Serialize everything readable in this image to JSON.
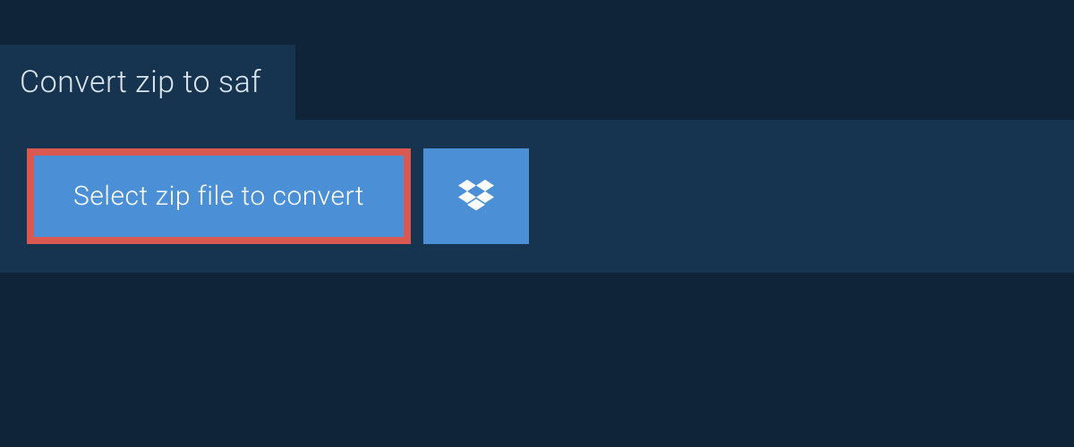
{
  "header": {
    "title": "Convert zip to saf"
  },
  "actions": {
    "select_file_label": "Select zip file to convert",
    "dropbox_icon_name": "dropbox-icon"
  },
  "colors": {
    "background_dark": "#0f2438",
    "panel": "#163450",
    "button_primary": "#4b90d6",
    "highlight_border": "#d9584f",
    "text_light": "#ffffff"
  }
}
